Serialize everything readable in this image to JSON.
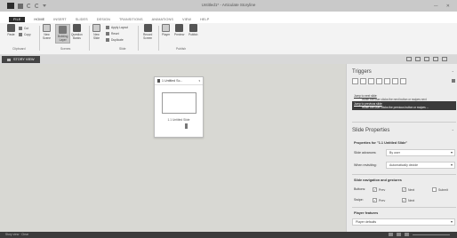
{
  "window": {
    "title": "Untitled1* - Articulate Storyline",
    "minimize": "—",
    "close": "✕"
  },
  "tabs": [
    "FILE",
    "HOME",
    "INSERT",
    "SLIDES",
    "DESIGN",
    "TRANSITIONS",
    "ANIMATIONS",
    "VIEW",
    "HELP"
  ],
  "ribbon": {
    "paste": "Paste",
    "cut": "Cut",
    "copy": "Copy",
    "new_scene": "New\nScene",
    "new_slide": "Building\nLayer",
    "question_bank": "Question\nBanks",
    "new_slide2": "New\nSlide",
    "apply_layout": "Apply Layout",
    "reset": "Reset",
    "duplicate": "Duplicate",
    "record_screen": "Record\nScreen",
    "player": "Player",
    "preview": "Preview",
    "publish": "Publish",
    "groups": {
      "clipboard": "Clipboard",
      "scenes": "Scenes",
      "slide": "Slide",
      "publish": "Publish"
    }
  },
  "story_view_label": "STORY VIEW",
  "scene": {
    "title": "1 Untitled Sc...",
    "slide_label": "1.1 Untitled Slide"
  },
  "triggers": {
    "heading": "Triggers",
    "items": [
      {
        "jump": "Jump to next slide",
        "cond": "When the user clicks the next button or swipes next",
        "selected": false
      },
      {
        "jump": "Jump to previous slide",
        "cond": "When the user clicks the previous button or swipes ...",
        "selected": true
      }
    ]
  },
  "slide_props": {
    "heading": "Slide Properties",
    "for_label": "Properties for \"1.1 Untitled Slide\"",
    "advances_label": "Slide advances:",
    "advances_value": "By user",
    "revisiting_label": "When revisiting:",
    "revisiting_value": "Automatically decide",
    "nav_heading": "Slide navigation and gestures",
    "buttons_label": "Buttons:",
    "prev": "Prev",
    "next": "Next",
    "submit": "Submit",
    "swipe_label": "Swipe:",
    "player_heading": "Player features",
    "player_value": "Player defaults"
  },
  "status": {
    "left": "Story view · Clear"
  }
}
